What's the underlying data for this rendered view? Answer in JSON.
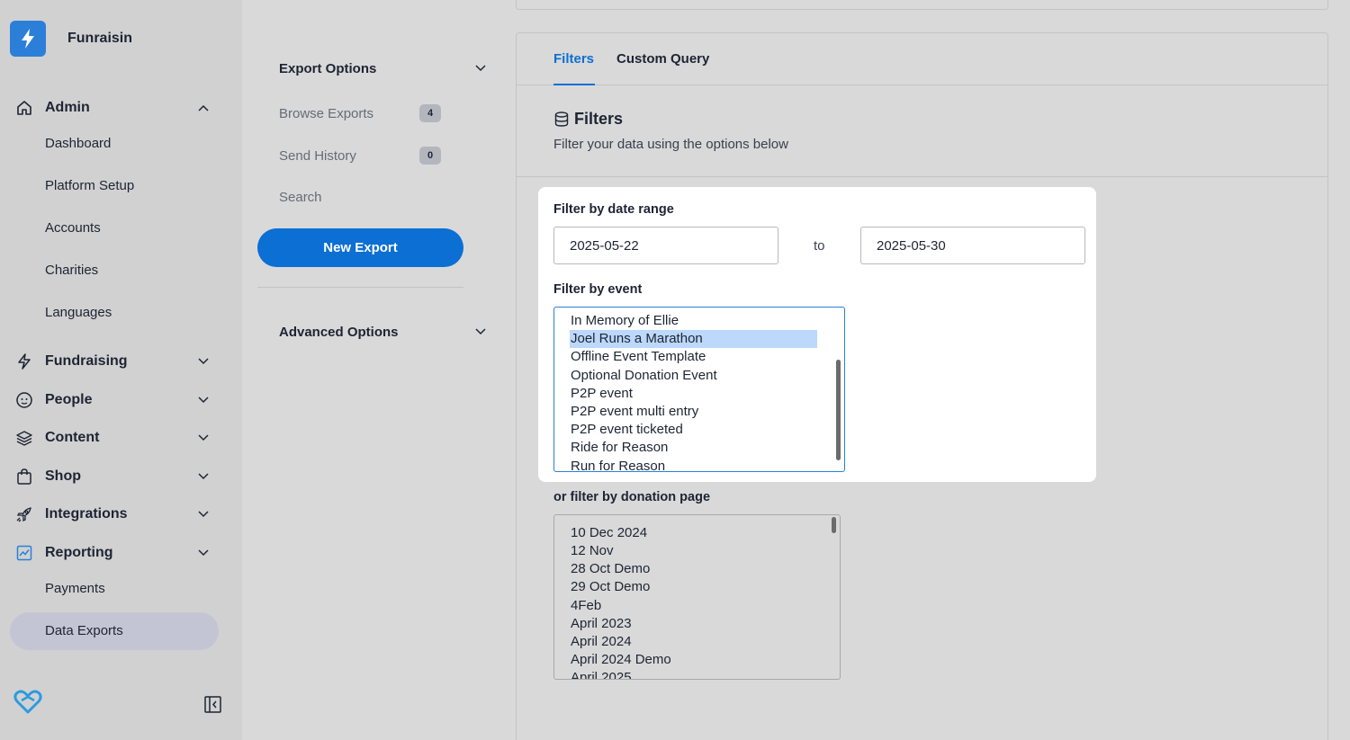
{
  "brand": {
    "name": "Funraisin"
  },
  "sidebar": {
    "admin": {
      "label": "Admin",
      "items": [
        "Dashboard",
        "Platform Setup",
        "Accounts",
        "Charities",
        "Languages"
      ]
    },
    "groups": [
      {
        "label": "Fundraising"
      },
      {
        "label": "People"
      },
      {
        "label": "Content"
      },
      {
        "label": "Shop"
      },
      {
        "label": "Integrations"
      }
    ],
    "reporting": {
      "label": "Reporting",
      "items": [
        "Payments",
        "Data Exports"
      ]
    }
  },
  "middle": {
    "export_options": "Export Options",
    "browse_exports": {
      "label": "Browse Exports",
      "count": "4"
    },
    "send_history": {
      "label": "Send History",
      "count": "0"
    },
    "search": "Search",
    "new_export": "New Export",
    "advanced_options": "Advanced Options"
  },
  "main": {
    "tabs": [
      "Filters",
      "Custom Query"
    ],
    "filters_title": "Filters",
    "filters_subtitle": "Filter your data using the options below",
    "date_range": {
      "label": "Filter by date range",
      "from": "2025-05-22",
      "to_label": "to",
      "to": "2025-05-30"
    },
    "event": {
      "label": "Filter by event",
      "options": [
        "In Memory of Ellie",
        "Joel Runs a Marathon",
        "Offline Event Template",
        "Optional Donation Event",
        "P2P event",
        "P2P event multi entry",
        "P2P event ticketed",
        "Ride for Reason",
        "Run for Reason"
      ],
      "selected": "Joel Runs a Marathon"
    },
    "donation_page": {
      "label": "or filter by donation page",
      "options": [
        "10 Dec 2024",
        "12 Nov",
        "28 Oct Demo",
        "29 Oct Demo",
        "4Feb",
        "April 2023",
        "April 2024",
        "April 2024 Demo",
        "April 2025"
      ]
    }
  },
  "colors": {
    "accent": "#0b6fd3",
    "selection": "#bcd8fa"
  }
}
